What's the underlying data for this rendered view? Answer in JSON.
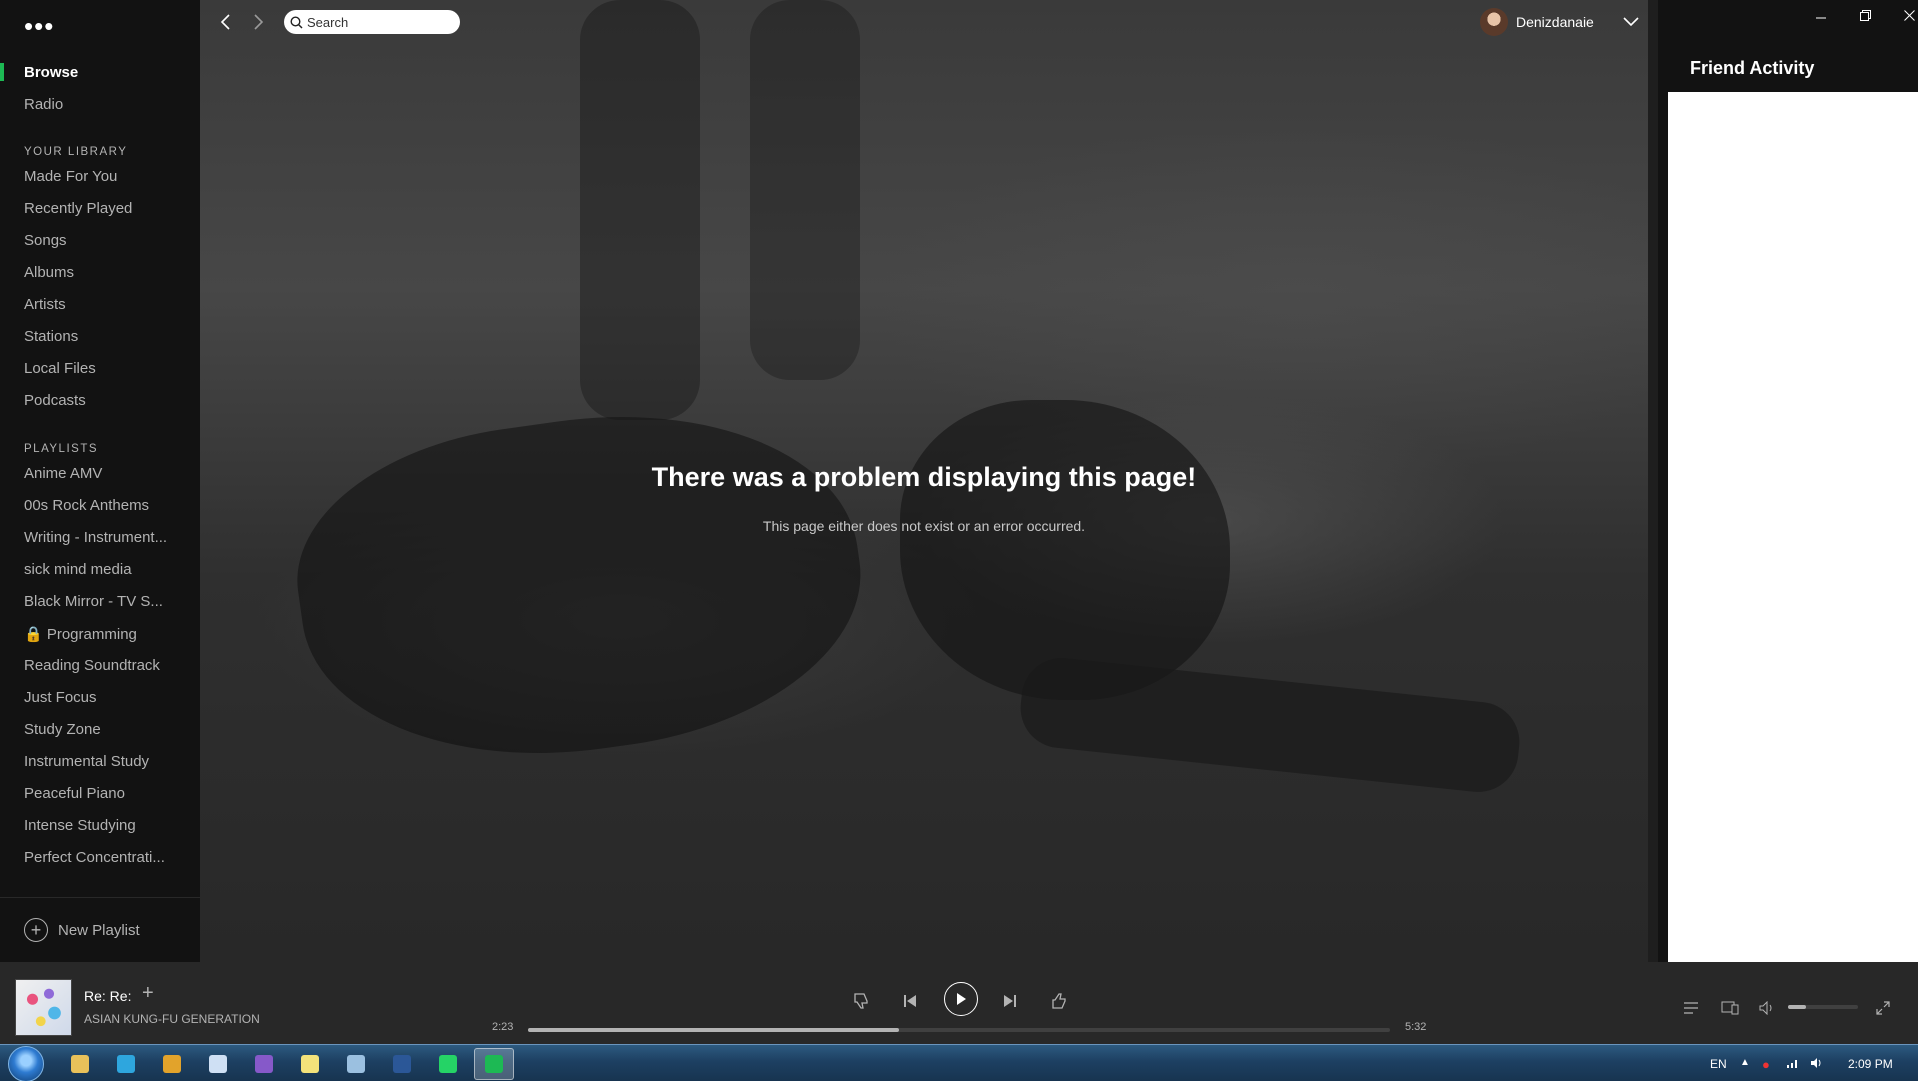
{
  "sidebar": {
    "menu_icon": "more-dots-icon",
    "nav": [
      {
        "label": "Browse",
        "active": true
      },
      {
        "label": "Radio",
        "active": false
      }
    ],
    "library_heading": "YOUR LIBRARY",
    "library": [
      "Made For You",
      "Recently Played",
      "Songs",
      "Albums",
      "Artists",
      "Stations",
      "Local Files",
      "Podcasts"
    ],
    "playlists_heading": "PLAYLISTS",
    "playlists": [
      "Anime AMV",
      "00s Rock Anthems",
      "Writing - Instrument...",
      "sick mind media",
      "Black Mirror - TV S...",
      "🔒 Programming",
      "Reading Soundtrack",
      "Just Focus",
      "Study Zone",
      "Instrumental Study",
      "Peaceful Piano",
      "Intense Studying",
      "Perfect Concentrati..."
    ],
    "new_playlist_label": "New Playlist"
  },
  "topbar": {
    "search_placeholder": "Search",
    "username": "Denizdanaie"
  },
  "main": {
    "error_title": "There was a problem displaying this page!",
    "error_subtitle": "This page either does not exist or an error occurred."
  },
  "friend_activity": {
    "title": "Friend Activity"
  },
  "player": {
    "track_title": "Re: Re:",
    "artist": "ASIAN KUNG-FU GENERATION",
    "elapsed": "2:23",
    "duration": "5:32",
    "progress_fraction": 0.43,
    "volume_fraction": 0.25
  },
  "taskbar": {
    "language": "EN",
    "clock": "2:09 PM",
    "apps": [
      {
        "name": "explorer",
        "color": "#e8c15a"
      },
      {
        "name": "telegram",
        "color": "#2ea6de"
      },
      {
        "name": "chrome",
        "color": "#e2a32b"
      },
      {
        "name": "notepad",
        "color": "#cfe0f4"
      },
      {
        "name": "visual-studio",
        "color": "#8659c9"
      },
      {
        "name": "sticky-notes",
        "color": "#f3e27a"
      },
      {
        "name": "paint",
        "color": "#9bc0e0"
      },
      {
        "name": "word",
        "color": "#2b5797"
      },
      {
        "name": "whatsapp",
        "color": "#25d366"
      },
      {
        "name": "spotify",
        "color": "#1db954",
        "active": true
      }
    ]
  },
  "colors": {
    "accent": "#1db954",
    "background": "#121212",
    "player_bar": "#282828"
  }
}
